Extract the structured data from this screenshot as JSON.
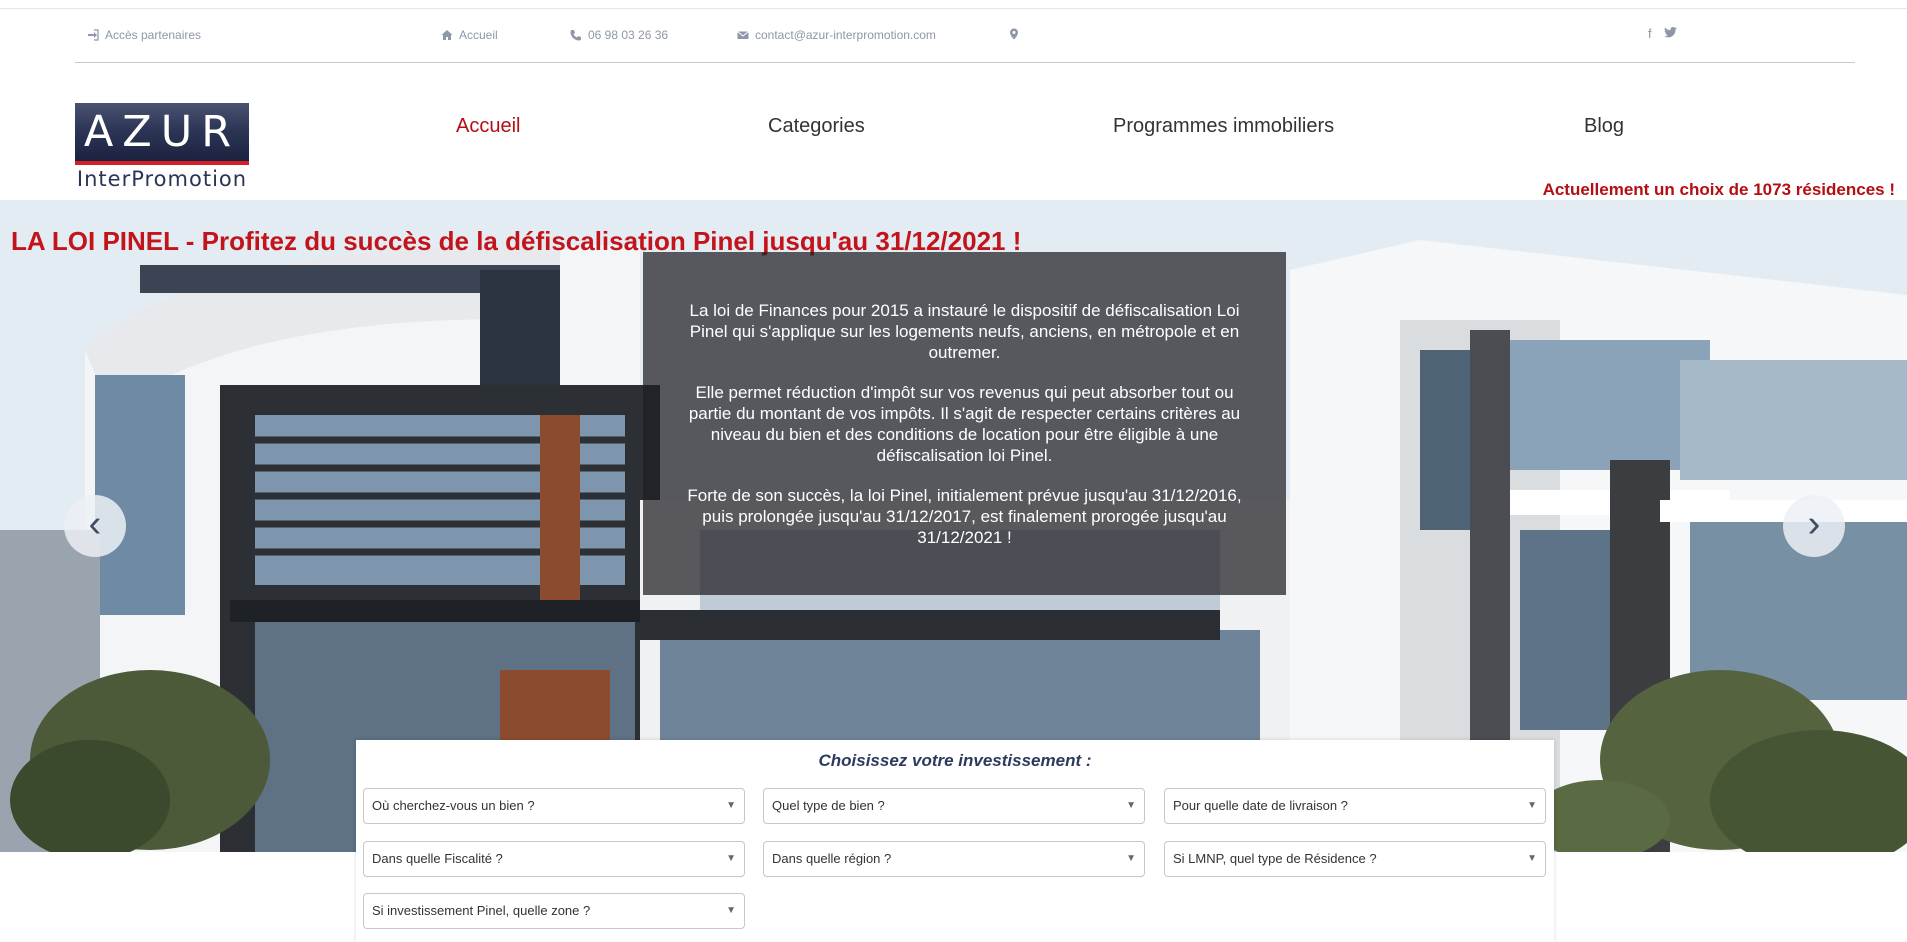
{
  "topbar": {
    "partners": {
      "icon": "sign-in-icon",
      "label": "Accès partenaires"
    },
    "home": {
      "icon": "home-icon",
      "label": "Accueil"
    },
    "phone": {
      "icon": "phone-icon",
      "label": "06 98 03 26 36"
    },
    "email": {
      "icon": "envelope-icon",
      "label": "contact@azur-interpromotion.com"
    },
    "location": {
      "icon": "map-marker-icon"
    },
    "social": [
      {
        "icon": "facebook-icon",
        "glyph": "f"
      },
      {
        "icon": "twitter-icon",
        "glyph": "t"
      }
    ]
  },
  "logo": {
    "main": "AZUR",
    "sub": "InterPromotion"
  },
  "nav": {
    "items": [
      {
        "label": "Accueil",
        "active": true
      },
      {
        "label": "Categories",
        "active": false
      },
      {
        "label": "Programmes immobiliers",
        "active": false
      },
      {
        "label": "Blog",
        "active": false
      }
    ]
  },
  "residences_banner": "Actuellement un choix de 1073 résidences !",
  "hero": {
    "title": "LA LOI PINEL - Profitez du succès de la défiscalisation Pinel jusqu'au 31/12/2021 !",
    "paragraphs": [
      "La loi de Finances pour 2015 a instauré le dispositif de défiscalisation Loi Pinel qui s'applique sur les logements neufs, anciens, en métropole et en outremer.",
      "Elle permet réduction d'impôt sur vos revenus qui peut absorber tout ou partie du montant de vos impôts. Il s'agit de respecter certains critères au niveau du bien et des conditions de location pour être éligible à une défiscalisation loi Pinel.",
      "Forte de son succès, la loi Pinel, initialement prévue jusqu'au 31/12/2016, puis prolongée jusqu'au 31/12/2017, est finalement prorogée jusqu'au 31/12/2021 !"
    ],
    "prev_glyph": "‹",
    "next_glyph": "›"
  },
  "search": {
    "title": "Choisissez votre investissement :",
    "selects": [
      "Où cherchez-vous un bien ?",
      "Quel type de bien ?",
      "Pour quelle date de livraison ?",
      "Dans quelle Fiscalité ?",
      "Dans quelle région ?",
      "Si LMNP, quel type de Résidence ?",
      "Si investissement Pinel, quelle zone ?"
    ],
    "caret": "▼"
  }
}
